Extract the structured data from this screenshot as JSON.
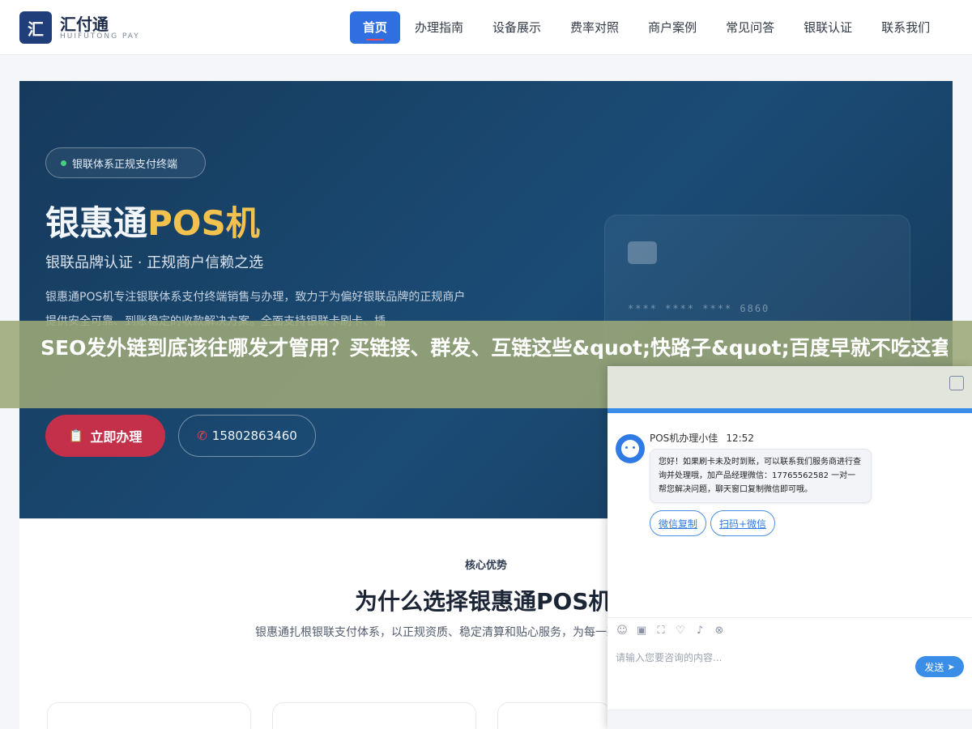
{
  "brand": {
    "logo_char": "汇",
    "name": "汇付通",
    "sub": "HUIFUTONG PAY"
  },
  "nav": {
    "items": [
      {
        "label": "首页",
        "active": true
      },
      {
        "label": "办理指南"
      },
      {
        "label": "设备展示"
      },
      {
        "label": "费率对照"
      },
      {
        "label": "商户案例"
      },
      {
        "label": "常见问答"
      },
      {
        "label": "银联认证"
      },
      {
        "label": "联系我们"
      }
    ]
  },
  "hero": {
    "badge": "银联体系正规支付终端",
    "title_main": "银惠通",
    "title_accent": "POS机",
    "subtitle": "银联品牌认证 · 正规商户信赖之选",
    "description": "银惠通POS机专注银联体系支付终端销售与办理，致力于为偏好银联品牌的正规商户提供安全可靠、到账稳定的收款解决方案。全面支持银联卡刷卡、插",
    "card_number": "**** **** **** 6860",
    "apply_button": "立即办理",
    "phone_button": "15802863460",
    "colors": {
      "accent": "#f2c14e",
      "apply": "#c4304a",
      "background": "#163a5c"
    }
  },
  "overlay": {
    "headline": "SEO发外链到底该往哪发才管用？买链接、群发、互链这些&quot;快路子&quot;百度早就不吃这套了，真正能带权重的外链就那么几类，发错地方"
  },
  "features": {
    "tag": "核心优势",
    "title": "为什么选择银惠通POS机",
    "description": "银惠通扎根银联支付体系，以正规资质、稳定清算和贴心服务，为每一款终端。"
  },
  "chat": {
    "agent_name": "POS机办理小佳",
    "time": "12:52",
    "message": "您好！如果刷卡未及时到账，可以联系我们服务商进行查询并处理哦，加产品经理微信：17765562582 一对一帮您解决问题，聊天窗口复制微信即可哦。",
    "quick_replies": [
      "微信复制",
      "扫码+微信"
    ],
    "input_placeholder": "请输入您要咨询的内容...",
    "send_label": "发送",
    "accent_color": "#3a8ee8"
  }
}
